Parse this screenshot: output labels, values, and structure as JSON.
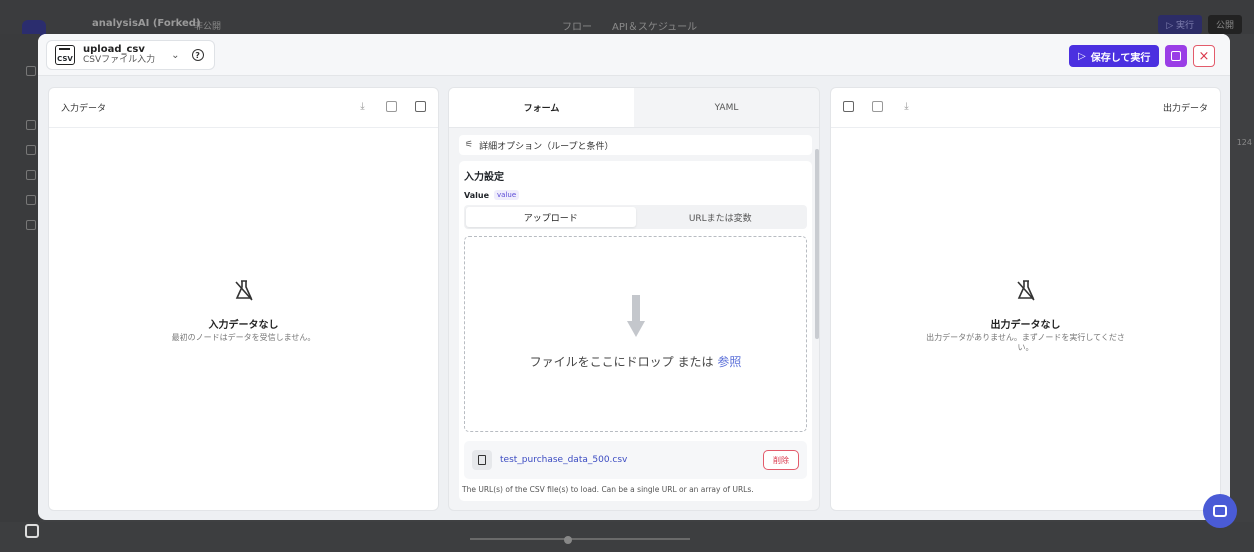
{
  "background_app": {
    "title": "analysisAI (Forked)",
    "visibility": "非公開",
    "center_tabs": "フロー　　API＆スケジュール",
    "run_label": "▷ 実行",
    "publish_label": "公開",
    "side_number": "124"
  },
  "modal": {
    "node": {
      "icon": "csv-file-icon",
      "name": "upload_csv",
      "subtitle": "CSVファイル入力"
    },
    "actions": {
      "save_run_label": "保存して実行",
      "save_icon": "save-icon",
      "close_label": "×"
    },
    "input_panel": {
      "title": "入力データ",
      "empty_title": "入力データなし",
      "empty_desc": "最初のノードはデータを受信しません。"
    },
    "form_panel": {
      "tabs": [
        "フォーム",
        "YAML"
      ],
      "advanced_label": "詳細オプション（ループと条件）",
      "section_title": "入力設定",
      "field_label": "Value",
      "field_tag": "value",
      "source_options": [
        "アップロード",
        "URLまたは変数"
      ],
      "drop_text": "ファイルをここにドロップ または",
      "browse_link": "参照",
      "file_name": "test_purchase_data_500.csv",
      "delete_label": "削除",
      "help_text": "The URL(s) of the CSV file(s) to load. Can be a single URL or an array of URLs."
    },
    "output_panel": {
      "title": "出力データ",
      "empty_title": "出力データなし",
      "empty_desc": "出力データがありません。まずノードを実行してください。"
    }
  },
  "colors": {
    "accent": "#4b30e0",
    "save": "#9a3ee6",
    "danger": "#d9364a",
    "link": "#5a6fd8"
  }
}
